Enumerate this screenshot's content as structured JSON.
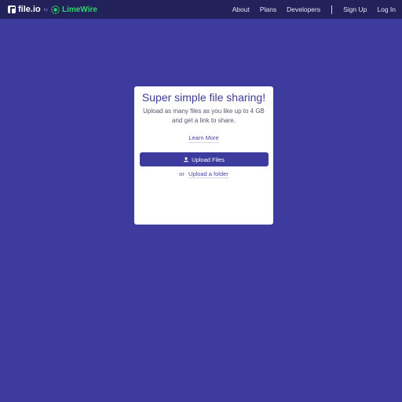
{
  "brand": {
    "name": "file.io",
    "by": "by",
    "partner": "LimeWire"
  },
  "nav": {
    "links": [
      "About",
      "Plans",
      "Developers"
    ],
    "auth": [
      "Sign Up",
      "Log In"
    ]
  },
  "card": {
    "title": "Super simple file sharing!",
    "subtitle_line1": "Upload as many files as you like up to 4 GB",
    "subtitle_line2": "and get a link to share.",
    "learn_more": "Learn More",
    "upload_button": "Upload Files",
    "or": "or",
    "upload_folder": "Upload a folder"
  },
  "colors": {
    "background": "#3d3b9e",
    "navbar": "#23215a",
    "accent": "#3d3b9e",
    "limewire_green": "#2fd36b"
  },
  "icons": {
    "brand": "file-io-logo-icon",
    "partner": "limewire-logo-icon",
    "upload": "upload-icon"
  }
}
